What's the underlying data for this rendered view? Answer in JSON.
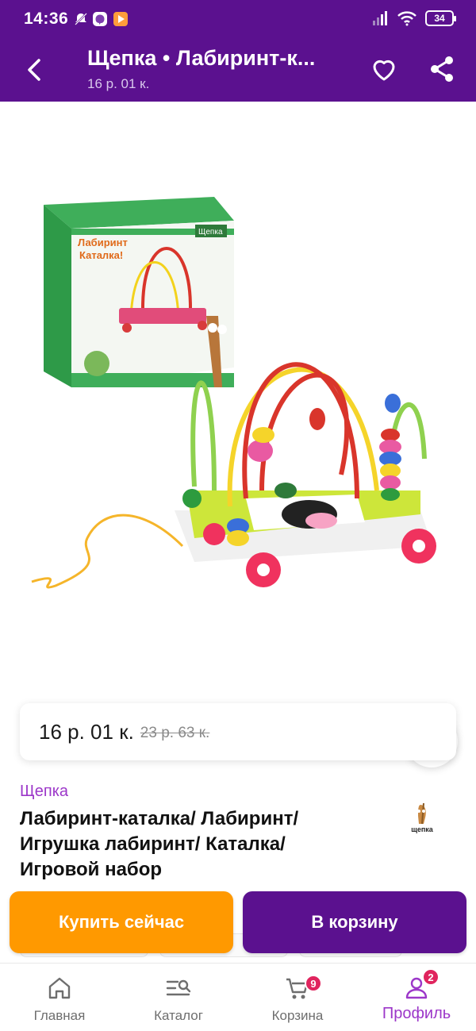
{
  "status_bar": {
    "time": "14:36",
    "battery": "34"
  },
  "app_bar": {
    "title": "Щепка • Лабиринт-к...",
    "subtitle": "16 р. 01 к."
  },
  "product": {
    "price_current": "16 р. 01 к.",
    "price_old": "23 р. 63 к.",
    "brand": "Щепка",
    "title": "Лабиринт-каталка/ Лабиринт/ Игрушка лабиринт/ Каталка/ Игровой набор",
    "brand_logo_text": "щепка",
    "box_text_line1": "Лабиринт",
    "box_text_line2": "Каталка!",
    "box_brand": "Щепка"
  },
  "actions": {
    "buy_now": "Купить сейчас",
    "add_to_cart": "В корзину"
  },
  "bottom_nav": {
    "items": [
      {
        "label": "Главная",
        "icon": "home-icon"
      },
      {
        "label": "Каталог",
        "icon": "catalog-search-icon"
      },
      {
        "label": "Корзина",
        "icon": "cart-icon",
        "badge": "9"
      },
      {
        "label": "Профиль",
        "icon": "profile-icon",
        "badge": "2",
        "active": true
      }
    ]
  },
  "colors": {
    "primary": "#5b118f",
    "accent_orange": "#ff9900",
    "brand_text": "#9c37c9",
    "badge": "#e0245e"
  }
}
